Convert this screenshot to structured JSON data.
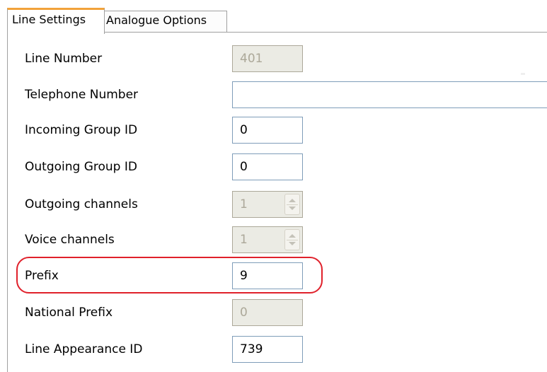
{
  "tabs": [
    {
      "label": "Line Settings",
      "active": true
    },
    {
      "label": "Analogue Options",
      "active": false
    }
  ],
  "fields": {
    "line_number": {
      "label": "Line Number",
      "value": "401",
      "enabled": false
    },
    "telephone_number": {
      "label": "Telephone Number",
      "value": "",
      "enabled": true
    },
    "incoming_group_id": {
      "label": "Incoming Group ID",
      "value": "0",
      "enabled": true
    },
    "outgoing_group_id": {
      "label": "Outgoing Group ID",
      "value": "0",
      "enabled": true
    },
    "outgoing_channels": {
      "label": "Outgoing channels",
      "value": "1",
      "enabled": false
    },
    "voice_channels": {
      "label": "Voice channels",
      "value": "1",
      "enabled": false
    },
    "prefix": {
      "label": "Prefix",
      "value": "9",
      "enabled": true,
      "highlighted": true
    },
    "national_prefix": {
      "label": "National Prefix",
      "value": "0",
      "enabled": false
    },
    "line_appearance_id": {
      "label": "Line Appearance ID",
      "value": "739",
      "enabled": true
    }
  },
  "colors": {
    "active_tab_accent": "#f2a23a",
    "highlight_ring": "#e0212b",
    "disabled_field_bg": "#ebebe4",
    "field_border": "#7f9db9"
  },
  "icons": {
    "spinner_up": "spinner-up-icon",
    "spinner_down": "spinner-down-icon"
  }
}
